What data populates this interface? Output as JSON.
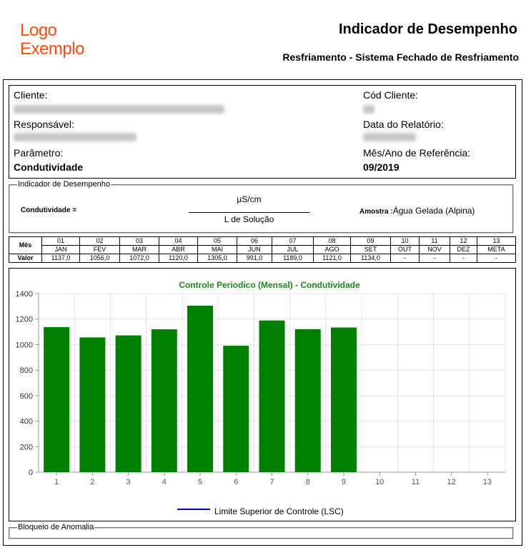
{
  "logo": {
    "line1": "Logo",
    "line2": "Exemplo"
  },
  "header": {
    "title": "Indicador de Desempenho",
    "subtitle": "Resfriamento - Sistema Fechado de Resfriamento"
  },
  "info": {
    "cliente_label": "Cliente:",
    "responsavel_label": "Responsável:",
    "parametro_label": "Parâmetro:",
    "parametro_value": "Condutividade",
    "cod_cliente_label": "Cód Cliente:",
    "data_relatorio_label": "Data do Relatório:",
    "mes_ano_label": "Mês/Ano de Referência:",
    "mes_ano_value": "09/2019"
  },
  "indicador": {
    "legend": "Indicador de Desempenho",
    "param_label": "Condutividade =",
    "numerator": "µS/cm",
    "denominator": "L de Solução",
    "amostra_label": "Amostra :",
    "amostra_value": "Água Gelada (Alpina)"
  },
  "table": {
    "mes_label": "Mês",
    "valor_label": "Valor",
    "columns": [
      {
        "num": "01",
        "month": "JAN",
        "value": "1137,0"
      },
      {
        "num": "02",
        "month": "FEV",
        "value": "1056,0"
      },
      {
        "num": "03",
        "month": "MAR",
        "value": "1072,0"
      },
      {
        "num": "04",
        "month": "ABR",
        "value": "1120,0"
      },
      {
        "num": "05",
        "month": "MAI",
        "value": "1305,0"
      },
      {
        "num": "06",
        "month": "JUN",
        "value": "991,0"
      },
      {
        "num": "07",
        "month": "JUL",
        "value": "1189,0"
      },
      {
        "num": "08",
        "month": "AGO",
        "value": "1121,0"
      },
      {
        "num": "09",
        "month": "SET",
        "value": "1134,0"
      },
      {
        "num": "10",
        "month": "OUT",
        "value": "-"
      },
      {
        "num": "11",
        "month": "NOV",
        "value": "-"
      },
      {
        "num": "12",
        "month": "DEZ",
        "value": "-"
      },
      {
        "num": "13",
        "month": "META",
        "value": "-"
      }
    ]
  },
  "chart_data": {
    "type": "bar",
    "title": "Controle Periodico (Mensal) - Condutividade",
    "categories": [
      "1",
      "2",
      "3",
      "4",
      "5",
      "6",
      "7",
      "8",
      "9",
      "10",
      "11",
      "12",
      "13"
    ],
    "values": [
      1137,
      1056,
      1072,
      1120,
      1305,
      991,
      1189,
      1121,
      1134,
      null,
      null,
      null,
      null
    ],
    "ylim": [
      0,
      1400
    ],
    "yticks": [
      0,
      200,
      400,
      600,
      800,
      1000,
      1200,
      1400
    ],
    "grid": true,
    "bar_color": "#008000",
    "legend": {
      "label": "Limite Superior de Controle (LSC)",
      "color": "#0000cc",
      "placement": "bottom"
    }
  },
  "bloqueio": {
    "legend": "Bloqueio de Anomalia"
  }
}
